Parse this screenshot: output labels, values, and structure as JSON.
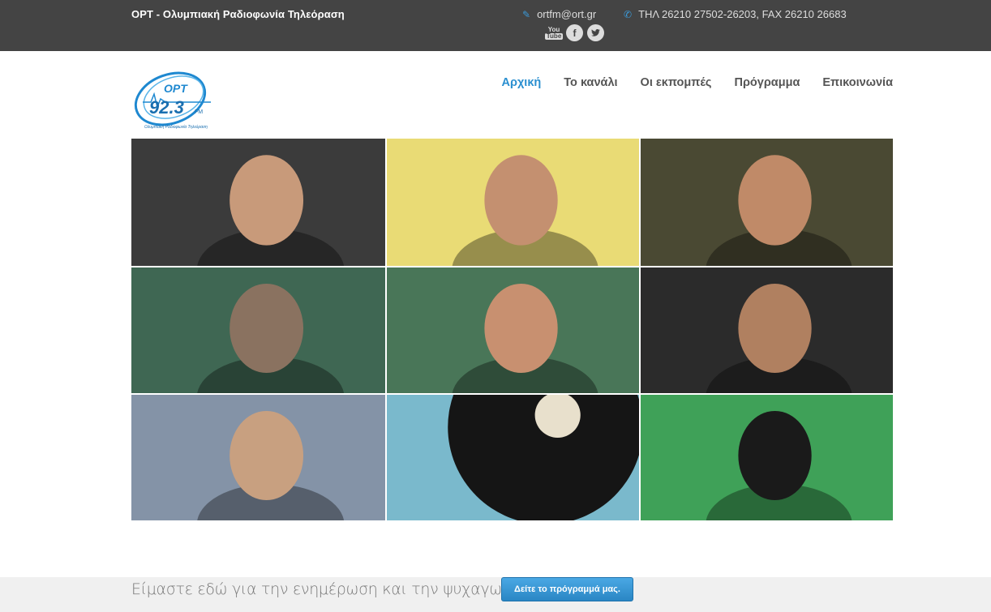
{
  "topbar": {
    "site_name": "ΟΡΤ - Ολυμπιακή Ραδιοφωνία Τηλεόραση",
    "email": "ortfm@ort.gr",
    "phone": "ΤΗΛ 26210 27502-26203, FAX 26210 26683",
    "socials": [
      {
        "icon": "youtube-icon"
      },
      {
        "icon": "facebook-icon"
      },
      {
        "icon": "twitter-icon"
      }
    ]
  },
  "logo": {
    "brand": "ΟΡΤ",
    "frequency": "92.3",
    "unit": "FM",
    "subtitle": "Ολυμπιακή Ραδιοφωνία Τηλεόραση"
  },
  "nav": {
    "items": [
      {
        "label": "Αρχική",
        "active": true
      },
      {
        "label": "Το κανάλι",
        "active": false
      },
      {
        "label": "Οι εκπομπές",
        "active": false
      },
      {
        "label": "Πρόγραμμα",
        "active": false
      },
      {
        "label": "Επικοινωνία",
        "active": false
      }
    ]
  },
  "gallery": {
    "tiles": [
      {
        "name": "photo-host-glasses-office",
        "bg": "#2b2b2b",
        "fg": "#c89a7a"
      },
      {
        "name": "photo-host-headphones-studio",
        "bg": "#e8d86a",
        "fg": "#c49070"
      },
      {
        "name": "photo-two-hosts-apple",
        "bg": "#3b3a22",
        "fg": "#c08a68"
      },
      {
        "name": "photo-host-headphones-green",
        "bg": "#2f5b45",
        "fg": "#8a7260"
      },
      {
        "name": "photo-host-woman-microphone",
        "bg": "#3a6b4a",
        "fg": "#c89070"
      },
      {
        "name": "photo-host-dark-room",
        "bg": "#1a1a1a",
        "fg": "#b08060"
      },
      {
        "name": "photo-host-outdoor-cafe",
        "bg": "#7a8aa0",
        "fg": "#c8a080"
      },
      {
        "name": "photo-vinyl-record",
        "bg": "#6fb3c8",
        "fg": "#151515"
      },
      {
        "name": "photo-host-studio-logo",
        "bg": "#2f9a4a",
        "fg": "#1a1a1a"
      }
    ]
  },
  "bottom": {
    "tagline": "Είμαστε εδώ για την ενημέρωση και την ψυχαγωγία σας!",
    "cta_label": "Δείτε το πρόγραμμά μας."
  },
  "colors": {
    "topbar": "#444444",
    "accent": "#2a8fd0",
    "button": "#3b9ad9"
  }
}
